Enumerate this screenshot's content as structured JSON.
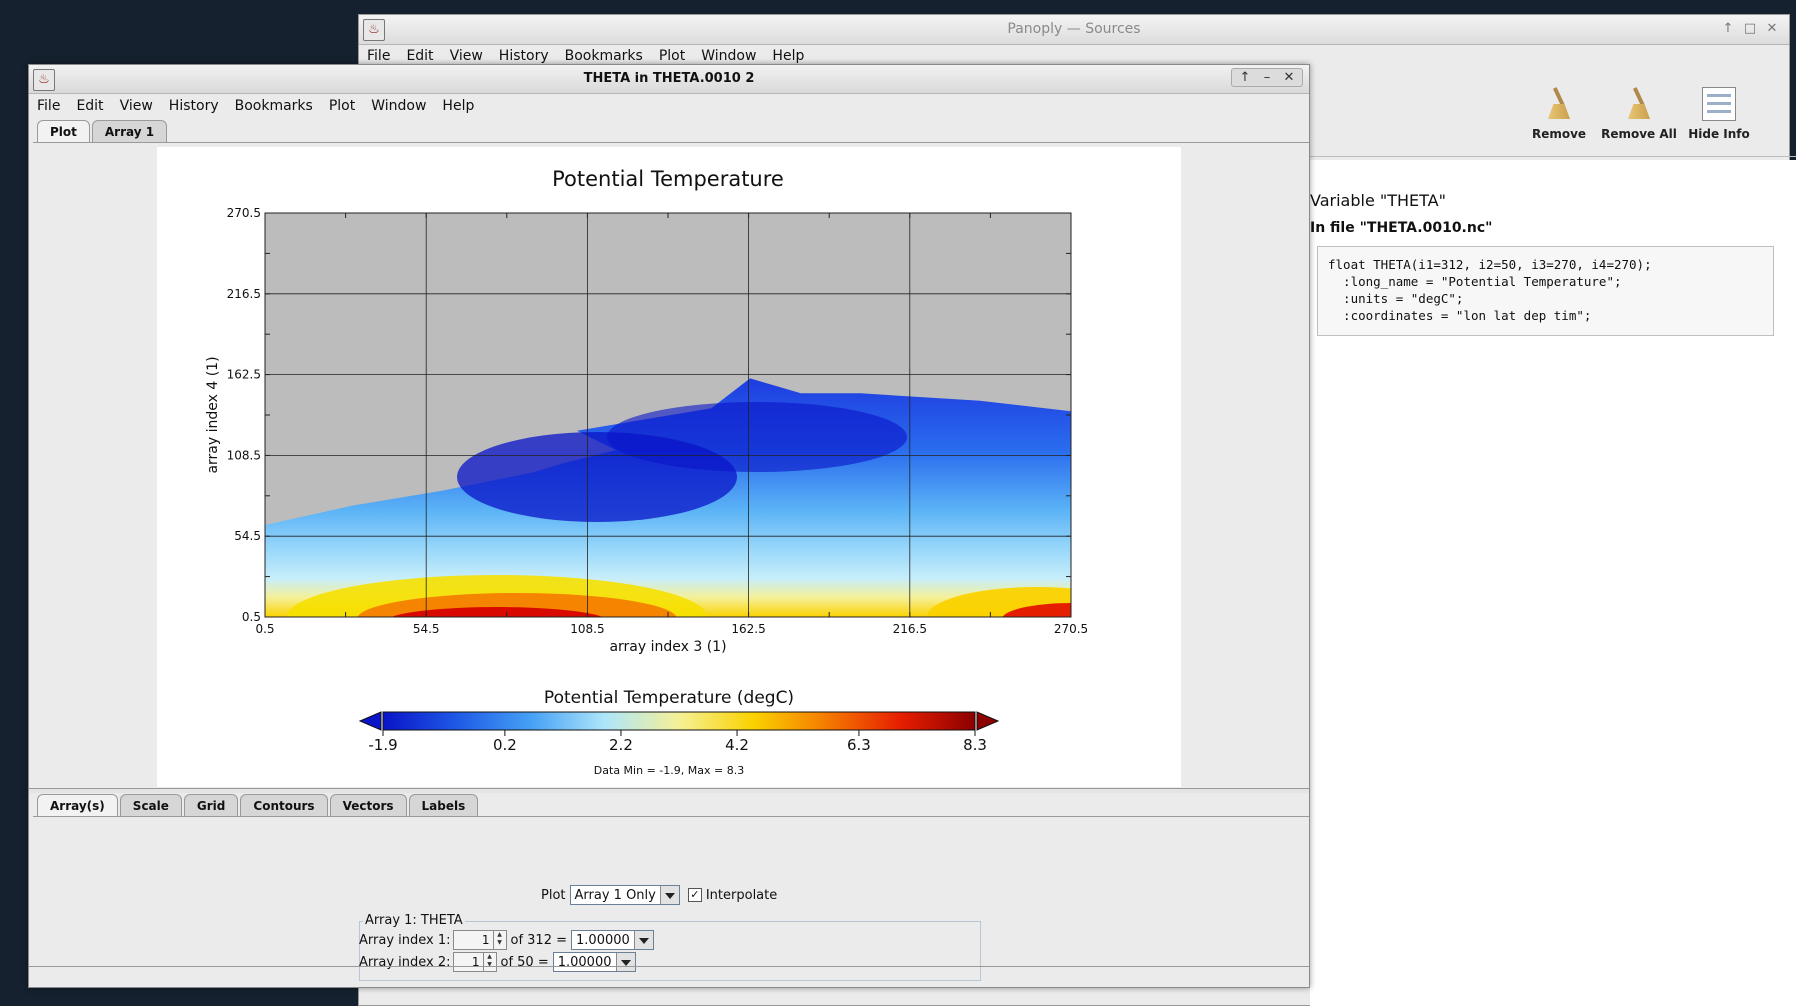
{
  "sources_window": {
    "title": "Panoply — Sources",
    "menu": [
      "File",
      "Edit",
      "View",
      "History",
      "Bookmarks",
      "Plot",
      "Window",
      "Help"
    ],
    "toolbar": {
      "remove": "Remove",
      "remove_all": "Remove All",
      "hide_info": "Hide Info"
    },
    "info": {
      "variable": "Variable \"THETA\"",
      "file": "In file \"THETA.0010.nc\"",
      "code": [
        "float THETA(i1=312, i2=50, i3=270, i4=270);",
        "  :long_name = \"Potential Temperature\";",
        "  :units = \"degC\";",
        "  :coordinates = \"lon lat dep tim\";"
      ]
    }
  },
  "plot_window": {
    "title": "THETA in THETA.0010 2",
    "menu": [
      "File",
      "Edit",
      "View",
      "History",
      "Bookmarks",
      "Plot",
      "Window",
      "Help"
    ],
    "top_tabs": [
      "Plot",
      "Array 1"
    ],
    "bottom_tabs": [
      "Array(s)",
      "Scale",
      "Grid",
      "Contours",
      "Vectors",
      "Labels"
    ],
    "controls": {
      "plot_label": "Plot",
      "plot_mode": "Array 1 Only",
      "interpolate_label": "Interpolate",
      "interpolate_checked": true,
      "group_title": "Array 1: THETA",
      "index1_label": "Array index 1:",
      "index1_value": "1",
      "index1_of": "of 312 =",
      "index1_coord": "1.00000",
      "index2_label": "Array index 2:",
      "index2_value": "1",
      "index2_of": "of 50 =",
      "index2_coord": "1.00000"
    }
  },
  "chart_data": {
    "type": "heatmap",
    "title": "Potential Temperature",
    "xlabel": "array index 3 (1)",
    "ylabel": "array index 4 (1)",
    "xlim": [
      0.5,
      270.5
    ],
    "ylim": [
      0.5,
      270.5
    ],
    "x_ticks": [
      0.5,
      54.5,
      108.5,
      162.5,
      216.5,
      270.5
    ],
    "y_ticks": [
      0.5,
      54.5,
      108.5,
      162.5,
      216.5,
      270.5
    ],
    "x_tick_labels": [
      "0.5",
      "54.5",
      "108.5",
      "162.5",
      "216.5",
      "270.5"
    ],
    "y_tick_labels": [
      "0.5",
      "54.5",
      "108.5",
      "162.5",
      "216.5",
      "270.5"
    ],
    "grid": true,
    "missing_color": "#bcbcbc",
    "colorbar": {
      "title": "Potential Temperature (degC)",
      "ticks": [
        -1.9,
        0.2,
        2.2,
        4.2,
        6.3,
        8.3
      ],
      "tick_labels": [
        "-1.9",
        "0.2",
        "2.2",
        "4.2",
        "6.3",
        "8.3"
      ],
      "colors": [
        "#0a14c8",
        "#1e5ae6",
        "#46a0f5",
        "#aee6fa",
        "#f5f096",
        "#fad200",
        "#f57a00",
        "#e61e00",
        "#8c0000"
      ]
    },
    "data_range_text": "Data Min = -1.9, Max = 8.3",
    "data_min": -1.9,
    "data_max": 8.3,
    "land_boundary": [
      [
        0.5,
        62
      ],
      [
        30,
        75
      ],
      [
        60,
        85
      ],
      [
        90,
        97
      ],
      [
        100,
        103
      ],
      [
        118,
        112
      ],
      [
        105,
        125
      ],
      [
        150,
        140
      ],
      [
        163,
        160
      ],
      [
        180,
        150
      ],
      [
        200,
        150
      ],
      [
        240,
        145
      ],
      [
        270.5,
        138
      ]
    ]
  }
}
